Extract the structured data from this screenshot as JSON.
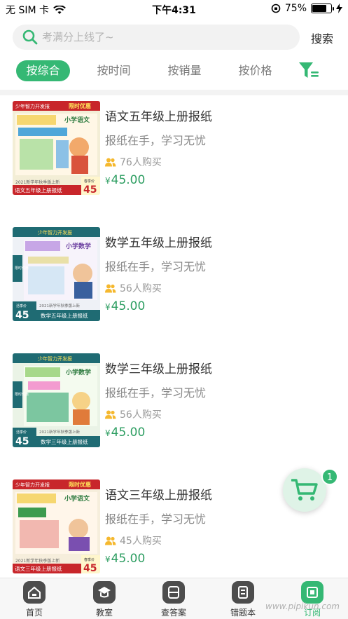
{
  "status_bar": {
    "carrier": "无 SIM 卡",
    "time": "下午4:31",
    "battery": "75%",
    "battery_level": 0.75
  },
  "search": {
    "placeholder": "考满分上线了~",
    "button": "搜索"
  },
  "sort_tabs": [
    {
      "label": "按综合",
      "active": true
    },
    {
      "label": "按时间",
      "active": false
    },
    {
      "label": "按销量",
      "active": false
    },
    {
      "label": "按价格",
      "active": false
    }
  ],
  "products": [
    {
      "title": "语文五年级上册报纸",
      "subtitle": "报纸在手，学习无忧",
      "buyers": "76人购买",
      "currency": "¥",
      "price": "45.00",
      "cover": {
        "banner": "少年智力开发报",
        "promo": "限时优惠",
        "paper": "小学语文",
        "band": "语文五年级上册报纸",
        "season": "2021新学年秋季版上新",
        "tag": "春季价",
        "price": "45"
      }
    },
    {
      "title": "数学五年级上册报纸",
      "subtitle": "报纸在手，学习无忧",
      "buyers": "56人购买",
      "currency": "¥",
      "price": "45.00",
      "cover": {
        "banner": "少年智力开发报",
        "promo": "限时优惠",
        "paper": "小学数学",
        "band": "数学五年级上册报纸",
        "season": "2021新学年秋季版上新",
        "tag": "活季价",
        "price": "45"
      }
    },
    {
      "title": "数学三年级上册报纸",
      "subtitle": "报纸在手，学习无忧",
      "buyers": "56人购买",
      "currency": "¥",
      "price": "45.00",
      "cover": {
        "banner": "少年智力开发报",
        "promo": "限时优惠",
        "paper": "小学数学",
        "band": "数学三年级上册报纸",
        "season": "2021新学年秋季版上新",
        "tag": "活季价",
        "price": "45"
      }
    },
    {
      "title": "语文三年级上册报纸",
      "subtitle": "报纸在手，学习无忧",
      "buyers": "45人购买",
      "currency": "¥",
      "price": "45.00",
      "cover": {
        "banner": "少年智力开发报",
        "promo": "限时优惠",
        "paper": "小学语文",
        "band": "语文三年级上册报纸",
        "season": "2021新学年秋季版上新",
        "tag": "春季价",
        "price": "45"
      }
    }
  ],
  "cart": {
    "count": "1"
  },
  "tabbar": [
    {
      "label": "首页",
      "icon": "home-icon",
      "active": false
    },
    {
      "label": "教室",
      "icon": "classroom-icon",
      "active": false
    },
    {
      "label": "查答案",
      "icon": "answer-icon",
      "active": false
    },
    {
      "label": "错题本",
      "icon": "mistakes-icon",
      "active": false
    },
    {
      "label": "订阅",
      "icon": "subscribe-icon",
      "active": true
    }
  ],
  "watermark": "www.pipikun.com",
  "colors": {
    "accent": "#35b874",
    "price": "#2e9e62",
    "cover_red": "#c8262b",
    "cover_teal": "#1f6b73"
  }
}
